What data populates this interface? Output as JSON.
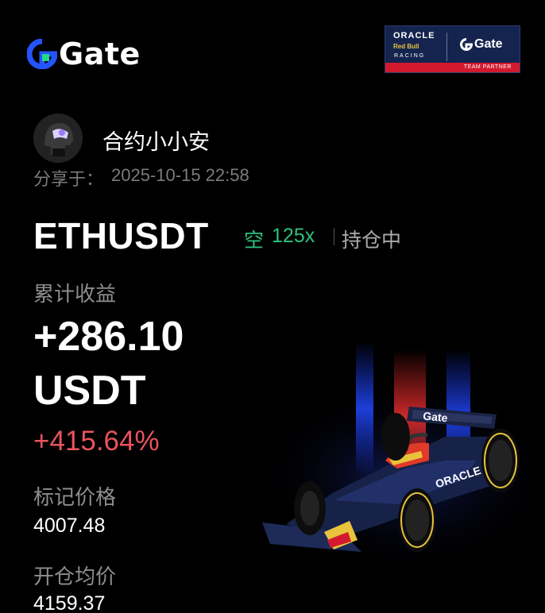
{
  "brand": {
    "name": "Gate",
    "color": "#2454ff"
  },
  "partner_badge": {
    "oracle": "ORACLE",
    "redbull": "Red Bull",
    "racing": "RACING",
    "gate": "Gate",
    "tag": "TEAM PARTNER"
  },
  "user": {
    "name": "合约小小安",
    "share_label": "分享于：",
    "share_time": "2025-10-15 22:58"
  },
  "position": {
    "symbol": "ETHUSDT",
    "side": "空",
    "leverage": "125x",
    "status": "持仓中"
  },
  "pnl": {
    "label": "累计收益",
    "amount": "+286.10",
    "currency": "USDT",
    "roi": "+415.64%"
  },
  "mark_price": {
    "label": "标记价格",
    "value": "4007.48"
  },
  "entry_price": {
    "label": "开仓均价",
    "value": "4159.37"
  },
  "colors": {
    "positive_green": "#2ec07e",
    "roi_red": "#e8535d",
    "muted": "#7b7b7b",
    "background": "#000000"
  }
}
